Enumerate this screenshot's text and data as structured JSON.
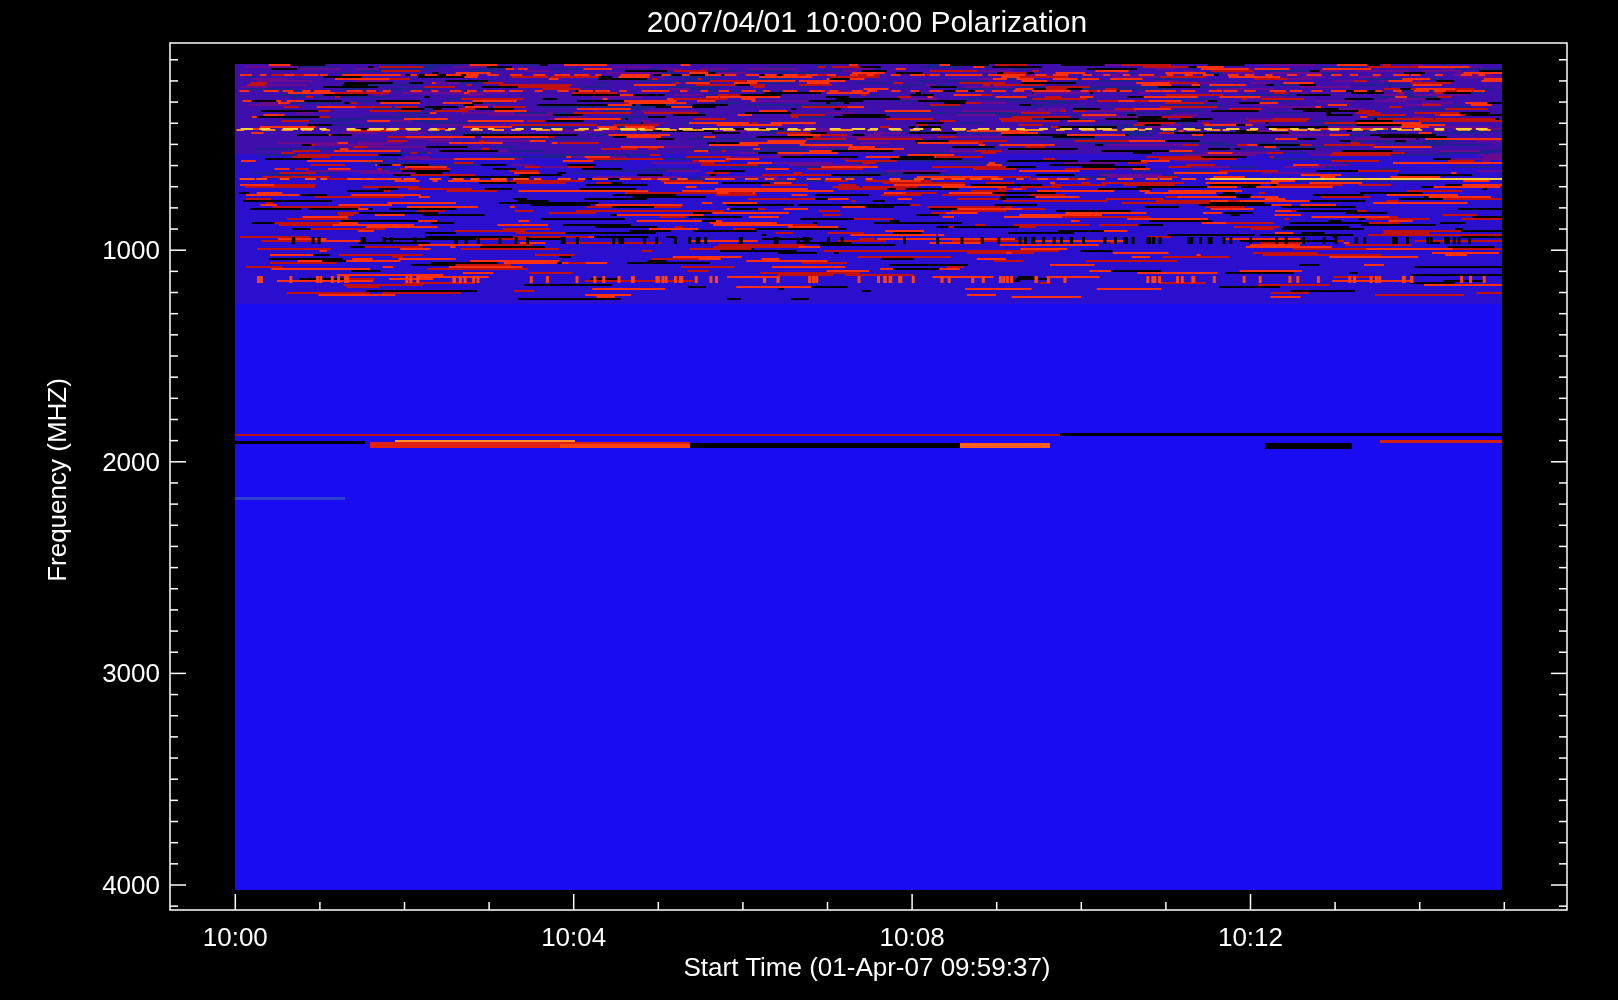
{
  "title": "2007/04/01 10:00:00 Polarization",
  "ylabel": "Frequency (MHZ)",
  "xlabel": "Start Time (01-Apr-07 09:59:37)",
  "yticks": [
    "1000",
    "2000",
    "3000",
    "4000"
  ],
  "xticks": [
    "10:00",
    "10:04",
    "10:08",
    "10:12"
  ]
}
